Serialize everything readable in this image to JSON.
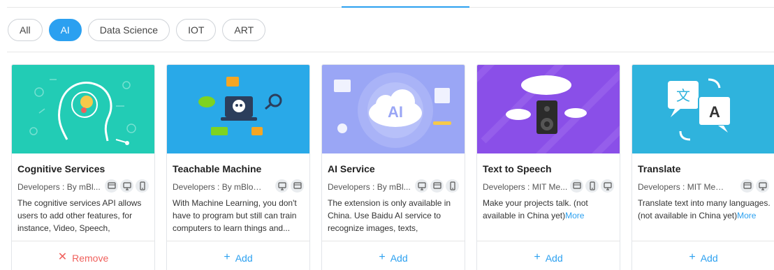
{
  "filters": [
    "All",
    "AI",
    "Data Science",
    "IOT",
    "ART"
  ],
  "active_filter": "AI",
  "colors": {
    "accent": "#2ba0f0",
    "remove": "#f0605c"
  },
  "cards": [
    {
      "title": "Cognitive Services",
      "developer": "Developers : By mBl...",
      "devices": [
        "stage-icon",
        "pc-icon",
        "mobile-icon"
      ],
      "description": "The cognitive services API allows users to add other features, for instance, Video, Speech, Languag...",
      "more": "",
      "action": "Remove",
      "action_icon": "close-icon"
    },
    {
      "title": "Teachable Machine",
      "developer": "Developers : By mBlock ...",
      "devices": [
        "pc-icon",
        "stage-icon"
      ],
      "description": "With Machine Learning, you don't have to program but still can train computers to learn things and...",
      "more": "",
      "action": "Add",
      "action_icon": "plus-icon"
    },
    {
      "title": "AI Service",
      "developer": "Developers : By mBl...",
      "devices": [
        "pc-icon",
        "stage-icon",
        "mobile-icon"
      ],
      "description": "The extension is only available in China. Use Baidu AI service to recognize images, texts, speeches,...",
      "more": "",
      "action": "Add",
      "action_icon": "plus-icon"
    },
    {
      "title": "Text to Speech",
      "developer": "Developers : MIT Me...",
      "devices": [
        "stage-icon",
        "mobile-icon",
        "pc-icon"
      ],
      "description": "Make your projects talk. (not available in China yet)",
      "more": "More",
      "action": "Add",
      "action_icon": "plus-icon"
    },
    {
      "title": "Translate",
      "developer": "Developers : MIT Media ...",
      "devices": [
        "stage-icon",
        "pc-icon"
      ],
      "description": "Translate text into many languages. (not available in China yet)",
      "more": "More",
      "action": "Add",
      "action_icon": "plus-icon"
    }
  ]
}
